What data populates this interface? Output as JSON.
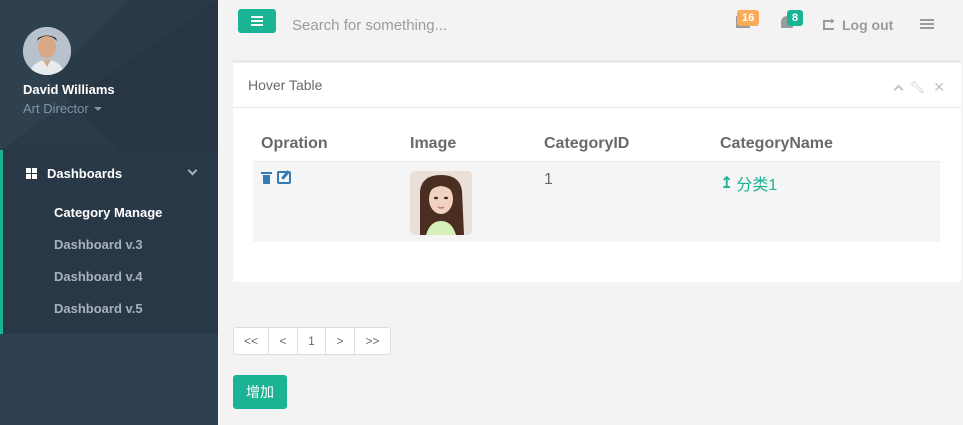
{
  "sidebar": {
    "user_name": "David Williams",
    "user_role": "Art Director",
    "nav_head": "Dashboards",
    "items": [
      {
        "label": "Category Manage",
        "active": true
      },
      {
        "label": "Dashboard v.3",
        "active": false
      },
      {
        "label": "Dashboard v.4",
        "active": false
      },
      {
        "label": "Dashboard v.5",
        "active": false
      }
    ]
  },
  "topbar": {
    "search_placeholder": "Search for something...",
    "messages_count": "16",
    "alerts_count": "8",
    "logout_label": "Log out"
  },
  "panel": {
    "title": "Hover Table",
    "columns": [
      "Opration",
      "Image",
      "CategoryID",
      "CategoryName"
    ],
    "rows": [
      {
        "id": "1",
        "name": "分类1"
      }
    ]
  },
  "pagination": {
    "first": "<<",
    "prev": "<",
    "page": "1",
    "next": ">",
    "last": ">>"
  },
  "add_button": "增加",
  "colors": {
    "accent": "#1ab394",
    "sidebar": "#2f4050",
    "warning": "#f8ac59",
    "link": "#337ab7"
  }
}
